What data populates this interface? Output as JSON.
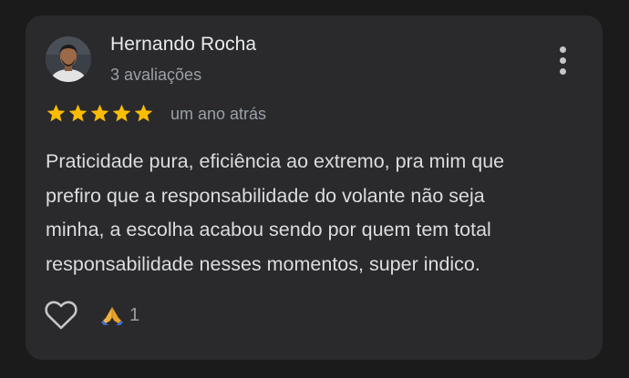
{
  "review": {
    "author_name": "Hernando Rocha",
    "author_review_count": "3 avaliações",
    "rating": 5,
    "max_rating": 5,
    "relative_time": "um ano atrás",
    "text_lines": [
      "Praticidade pura, eficiência ao extremo, pra mim que",
      "prefiro que a responsabilidade do volante não seja",
      "minha, a escolha acabou sendo por quem tem total",
      "responsabilidade nesses momentos, super indico."
    ],
    "reaction_icon": "folded-hands-emoji",
    "reaction_count": "1"
  },
  "icons": {
    "menu": "more-vert-icon",
    "star": "star-icon",
    "like": "heart-outline-icon"
  },
  "colors": {
    "background": "#1b1b1c",
    "card": "#2a2a2c",
    "star": "#fbbc04",
    "primary_text": "#e8eaed",
    "secondary_text": "#9aa0a6"
  }
}
